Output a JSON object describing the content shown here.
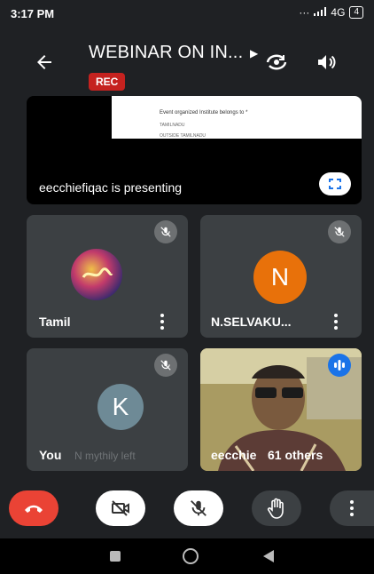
{
  "status_bar": {
    "time": "3:17 PM",
    "network": "4G",
    "battery": "4"
  },
  "header": {
    "title": "WEBINAR ON IN...",
    "rec_badge": "REC"
  },
  "presentation": {
    "presenter_text": "eecchiefiqac is presenting",
    "slide_question": "Event organized  Institute belongs  to *",
    "slide_option_1": "TAMILNADU",
    "slide_option_2": "OUTSIDE TAMILNADU"
  },
  "tiles": [
    {
      "name": "Tamil",
      "muted": true
    },
    {
      "name": "N.SELVAKU...",
      "avatar_letter": "N",
      "avatar_color": "#e8710a",
      "muted": true
    },
    {
      "name": "You",
      "notice": "N mythily left",
      "avatar_letter": "K",
      "avatar_color": "#6e8a96",
      "muted": true
    },
    {
      "name": "eecchie",
      "others": "61 others",
      "speaking": true
    }
  ],
  "colors": {
    "background": "#1f2124",
    "tile": "#3c4043",
    "end_call": "#ea4335",
    "rec": "#c5221f",
    "speaking": "#1a73e8"
  }
}
